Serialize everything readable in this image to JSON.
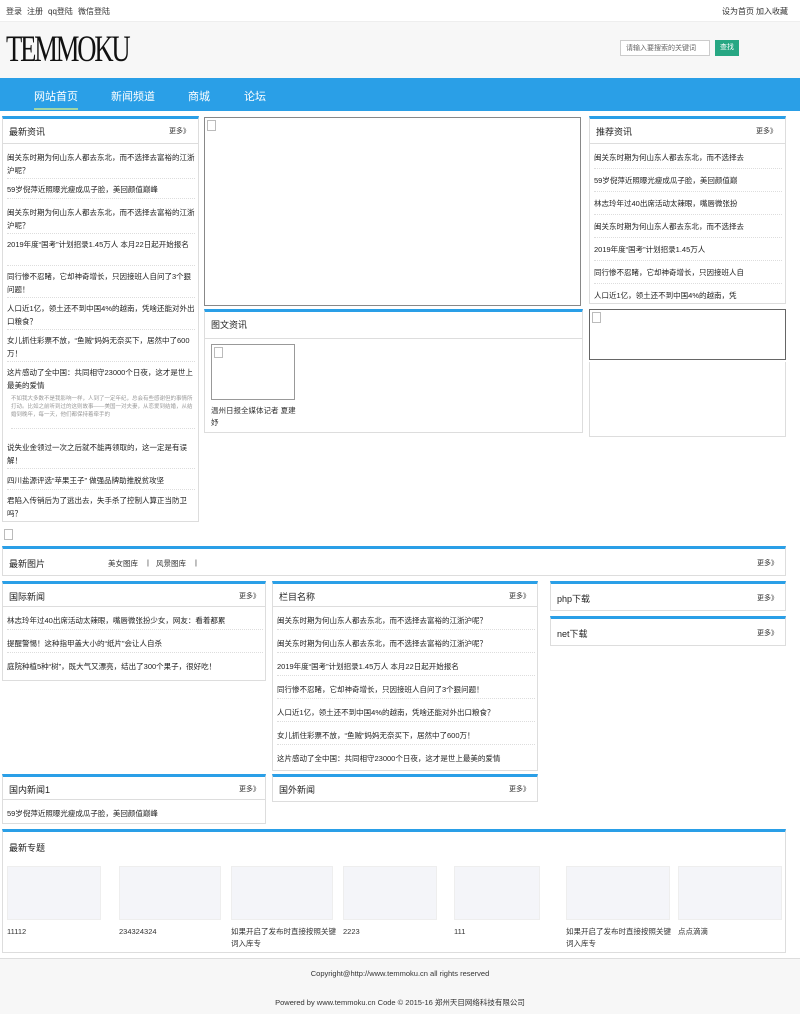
{
  "topbar": {
    "login": "登录",
    "register": "注册",
    "qq": "qq登陆",
    "wechat": "微信登陆",
    "homepage": "设为首页",
    "favorite": "加入收藏"
  },
  "logo": "TEMMOKU",
  "search": {
    "placeholder": "请输入要搜索的关键词",
    "button": "查找"
  },
  "nav": [
    "网站首页",
    "新闻频道",
    "商城",
    "论坛"
  ],
  "more": "更多》",
  "latest": {
    "title": "最新资讯",
    "items": [
      "闽关东时期为何山东人都去东北，而不选择去富裕的江浙沪呢？",
      "59岁倪萍近照曝光瘦成瓜子脸，美回颜值巅峰",
      "闽关东时期为何山东人都去东北，而不选择去富裕的江浙沪呢？",
      "2019年度“国考”计划招录1.45万人 本月22日起开始报名",
      "同行惨不忍睹，它却神奇增长，只因接班人自问了3个狠问题！",
      "人口近1亿，领土还不到中国4%的越南，凭啥还能对外出口粮食？",
      "女儿抓住彩票不放，“鱼贼”妈妈无奈买下，居然中了600万！",
      "这片感动了全中国：共同相守23000个日夜，这才是世上最美的爱情",
      "说失业金领过一次之后就不能再领取的，这一定是有误解！",
      "四川盐源评选“苹果王子” 做强品牌助推脱贫攻坚",
      "君陷入传销后为了逃出去，失手杀了控制人算正当防卫吗？"
    ],
    "desc": "不如我大多数不是我影响一样，人到了一定年纪，总会有些感谢但的事情所打动。比如之前听到过的这则故事——美国一对夫妻，从恋爱到结婚，从结婚到晚年，每一天，他们都保持着牵手的"
  },
  "imgnews": {
    "title": "图文资讯",
    "caption": "温州日报全媒体记者 夏建妤"
  },
  "recommend": {
    "title": "推荐资讯",
    "items": [
      "闽关东时期为何山东人都去东北，而不选择去",
      "59岁倪萍近照曝光瘦成瓜子脸，美回颜值巅",
      "林志玲年过40出席活动太辣眼，嘴唇微张扮",
      "闽关东时期为何山东人都去东北，而不选择去",
      "2019年度“国考”计划招录1.45万人",
      "同行惨不忍睹，它却神奇增长，只因接班人自",
      "人口近1亿，领土还不到中国4%的越南，凭"
    ]
  },
  "pics": {
    "title": "最新图片",
    "links": [
      "美女图库",
      "风景图库"
    ],
    "sep": "|"
  },
  "intl": {
    "title": "国际新闻",
    "items": [
      "林志玲年过40出席活动太辣眼，嘴唇微张扮少女，网友：看着都累",
      "提醒警惕！这种指甲盖大小的“纸片”会让人自杀",
      "庭院种植5种“树”，既大气又漂亮，结出了300个果子，很好吃！"
    ]
  },
  "column": {
    "title": "栏目名称",
    "items": [
      "闽关东时期为何山东人都去东北，而不选择去富裕的江浙沪呢？",
      "闽关东时期为何山东人都去东北，而不选择去富裕的江浙沪呢？",
      "2019年度“国考”计划招录1.45万人 本月22日起开始报名",
      "同行惨不忍睹，它却神奇增长，只因接班人自问了3个狠问题！",
      "人口近1亿，领土还不到中国4%的越南，凭啥还能对外出口粮食？",
      "女儿抓住彩票不放，“鱼贼”妈妈无奈买下，居然中了600万！",
      "这片感动了全中国：共同相守23000个日夜，这才是世上最美的爱情"
    ]
  },
  "php": {
    "title": "php下载"
  },
  "net": {
    "title": "net下载"
  },
  "domestic": {
    "title": "国内新闻1",
    "items": [
      "59岁倪萍近照曝光瘦成瓜子脸，美回颜值巅峰"
    ]
  },
  "foreign": {
    "title": "国外新闻"
  },
  "topics": {
    "title": "最新专题",
    "items": [
      "11112",
      "234324324",
      "如果开启了发布时直接按照关键词入库专",
      "2223",
      "111",
      "如果开启了发布时直接按照关键词入库专",
      "点点滴滴"
    ]
  },
  "footer": {
    "copyright": "Copyright@http://www.temmoku.cn all rights reserved",
    "powered": "Powered by www.temmoku.cn Code © 2015-16 郑州天目网络科技有限公司"
  }
}
